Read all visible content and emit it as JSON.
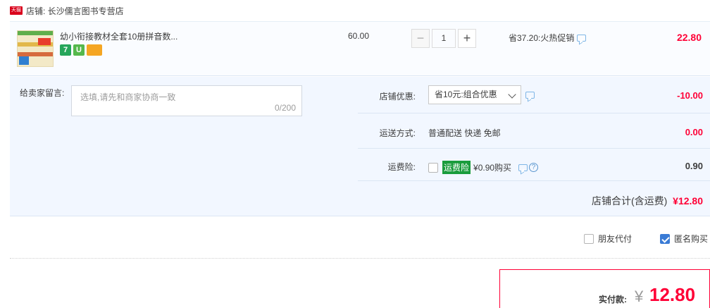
{
  "shop": {
    "badge": "天猫",
    "name": "店铺: 长沙儒言图书专营店"
  },
  "item": {
    "title": "幼小衔接教材全套10册拼音数...",
    "badges": [
      "7",
      "U",
      "card"
    ],
    "unit_price": "60.00",
    "quantity": "1",
    "minus": "−",
    "plus": "+",
    "promo": "省37.20:火热促销",
    "subtotal": "22.80"
  },
  "message": {
    "label": "给卖家留言:",
    "placeholder": "选填,请先和商家协商一致",
    "count": "0/200"
  },
  "discount": {
    "label": "店铺优惠:",
    "selected": "省10元:组合优惠",
    "amount": "-10.00"
  },
  "shipping": {
    "label": "运送方式:",
    "value": "普通配送 快递 免邮",
    "amount": "0.00"
  },
  "insurance": {
    "label": "运费险:",
    "tag": "运费险",
    "value": "¥0.90购买",
    "help": "?",
    "amount": "0.90"
  },
  "shop_total": {
    "label": "店铺合计(含运费)",
    "amount": "¥12.80"
  },
  "options": {
    "friend_pay": "朋友代付",
    "anonymous": "匿名购买"
  },
  "payment": {
    "label": "实付款:",
    "currency": "¥",
    "amount": "12.80"
  },
  "colors": {
    "accent": "#ff0036",
    "panel": "#f2f7ff",
    "checkbox_checked": "#3a7bd5"
  }
}
